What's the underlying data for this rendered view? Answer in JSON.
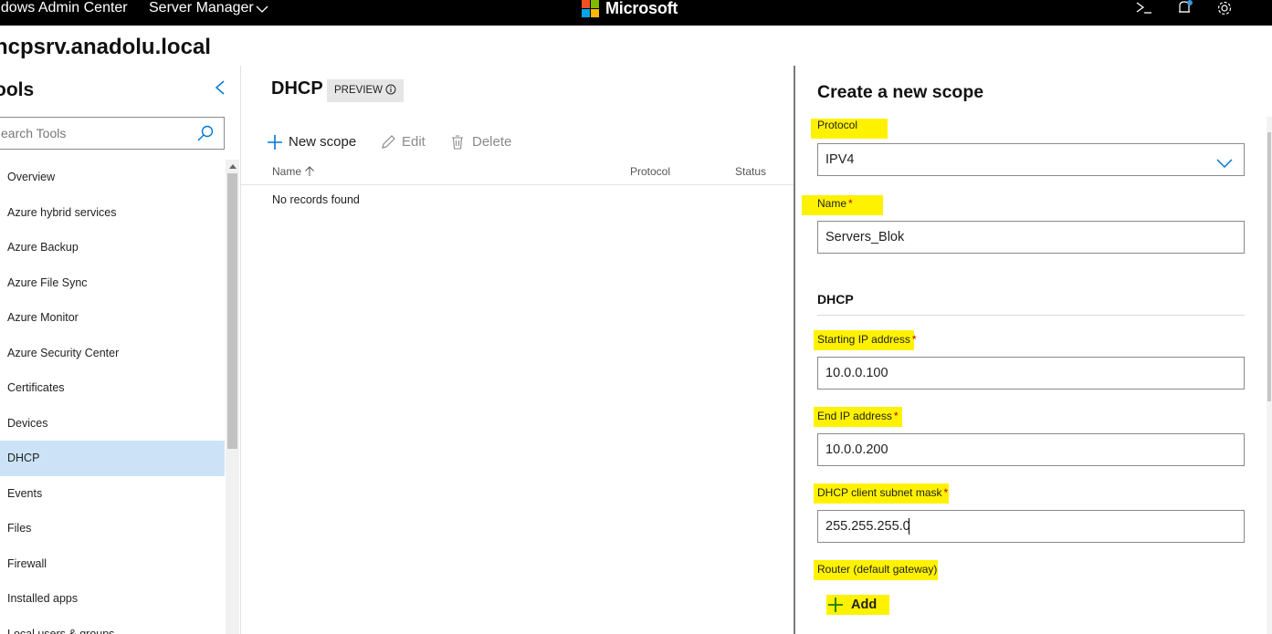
{
  "topbar": {
    "app_title": "ndows Admin Center",
    "server_manager": "Server Manager",
    "brand": "Microsoft",
    "brand_colors": [
      "#f25022",
      "#7fba00",
      "#00a4ef",
      "#ffb900"
    ],
    "icons": [
      "powershell-icon",
      "notifications-icon",
      "settings-icon"
    ]
  },
  "server": {
    "name": "hcpsrv.anadolu.local"
  },
  "tools": {
    "title": "ools",
    "search_placeholder": "earch Tools",
    "items": [
      "Overview",
      "Azure hybrid services",
      "Azure Backup",
      "Azure File Sync",
      "Azure Monitor",
      "Azure Security Center",
      "Certificates",
      "Devices",
      "DHCP",
      "Events",
      "Files",
      "Firewall",
      "Installed apps",
      "Local users & groups"
    ],
    "selected": "DHCP",
    "selected_color": "#cce3f7"
  },
  "main": {
    "title": "DHCP",
    "badge": "PREVIEW",
    "toolbar": {
      "new_scope": "New scope",
      "edit": "Edit",
      "delete": "Delete"
    },
    "columns": {
      "name": "Name",
      "protocol": "Protocol",
      "status": "Status"
    },
    "empty_text": "No records found",
    "accent": "#0078d4"
  },
  "panel": {
    "title": "Create a new scope",
    "protocol_label": "Protocol",
    "protocol_value": "IPV4",
    "name_label": "Name",
    "name_value": "Servers_Blok",
    "required_mark": "*",
    "section": "DHCP",
    "start_ip_label": "Starting IP address",
    "start_ip_value": "10.0.0.100",
    "end_ip_label": "End IP address",
    "end_ip_value": "10.0.0.200",
    "subnet_label": "DHCP client subnet mask",
    "subnet_value": "255.255.255.0",
    "router_label": "Router (default gateway)",
    "add_label": "Add",
    "highlight_color": "#fff200",
    "add_icon_color": "#107c10"
  }
}
